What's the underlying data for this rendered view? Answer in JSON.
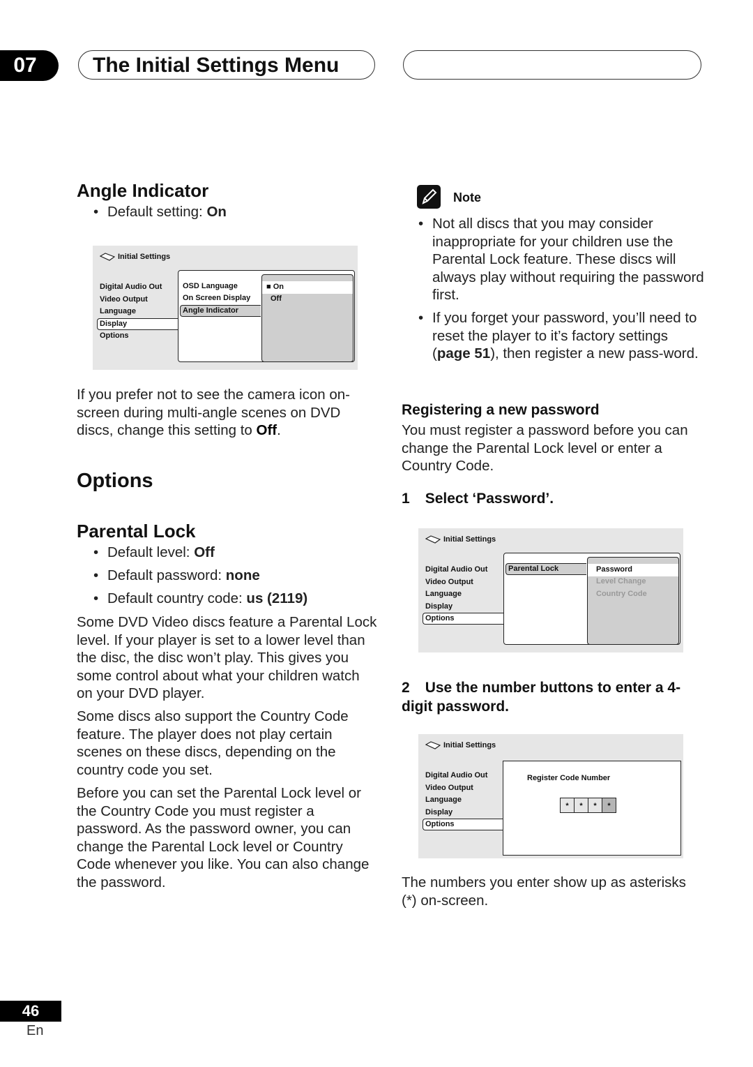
{
  "header": {
    "chapter_number": "07",
    "chapter_title": "The Initial Settings Menu"
  },
  "angle_indicator": {
    "heading": "Angle Indicator",
    "default_label": "Default setting: ",
    "default_value": "On",
    "description_prefix": "If you prefer not to see the camera icon on-screen during multi-angle scenes on DVD discs, change this setting to ",
    "description_value": "Off",
    "description_suffix": "."
  },
  "osd_angle": {
    "title": "Initial Settings",
    "left_menu": [
      "Digital Audio Out",
      "Video Output",
      "Language",
      "Display",
      "Options"
    ],
    "left_selected": "Display",
    "mid_menu": [
      "OSD Language",
      "On Screen Display",
      "Angle Indicator"
    ],
    "mid_selected": "Angle Indicator",
    "right_menu": [
      "On",
      "Off"
    ],
    "right_selected": "On",
    "selected_marker": "■"
  },
  "options": {
    "heading": "Options"
  },
  "parental_lock": {
    "heading": "Parental Lock",
    "bullets": [
      {
        "label": "Default level: ",
        "value": "Off"
      },
      {
        "label": "Default password: ",
        "value": "none"
      },
      {
        "label": "Default country code: ",
        "value": "us (2119)"
      }
    ],
    "paragraphs": [
      "Some DVD Video discs feature a Parental Lock level. If your player is set to a lower level than the disc, the disc won’t play. This gives you some control about what your children watch on your DVD player.",
      "Some discs also support the Country Code feature. The player does not play certain scenes on these discs, depending on the country code you set.",
      "Before you can set the Parental Lock level or the Country Code you must register a password. As the password owner, you can change the Parental Lock level or Country Code whenever you like. You can also change the password."
    ]
  },
  "note": {
    "title": "Note",
    "items": [
      {
        "text": "Not all discs that you may consider inappropriate for your children use the Parental Lock feature. These discs will always play without requiring the password first."
      },
      {
        "prefix": "If you forget your password, you’ll need to reset the player to it’s factory settings (",
        "bold": "page 51",
        "suffix": "), then register a new pass-word."
      }
    ]
  },
  "registering": {
    "heading": "Registering a new password",
    "intro": "You must register a password before you can change the Parental Lock level or enter a Country Code.",
    "step1_number": "1",
    "step1_text": "Select ‘Password’.",
    "step2_number": "2",
    "step2_text": "Use the number buttons to enter a 4-digit password.",
    "outro": "The numbers you enter show up as asterisks (*) on-screen."
  },
  "osd_password": {
    "title": "Initial Settings",
    "left_menu": [
      "Digital Audio Out",
      "Video Output",
      "Language",
      "Display",
      "Options"
    ],
    "left_selected": "Options",
    "mid_menu": [
      "Parental Lock"
    ],
    "mid_selected": "Parental Lock",
    "right_menu": [
      "Password",
      "Level Change",
      "Country Code"
    ],
    "right_selected": "Password",
    "right_disabled": [
      "Level Change",
      "Country Code"
    ]
  },
  "osd_register": {
    "title": "Initial Settings",
    "left_menu": [
      "Digital Audio Out",
      "Video Output",
      "Language",
      "Display",
      "Options"
    ],
    "left_selected": "Options",
    "prompt": "Register Code Number",
    "code_digits": [
      "*",
      "*",
      "*",
      "*"
    ],
    "active_digit_index": 3
  },
  "footer": {
    "page_number": "46",
    "language": "En"
  }
}
